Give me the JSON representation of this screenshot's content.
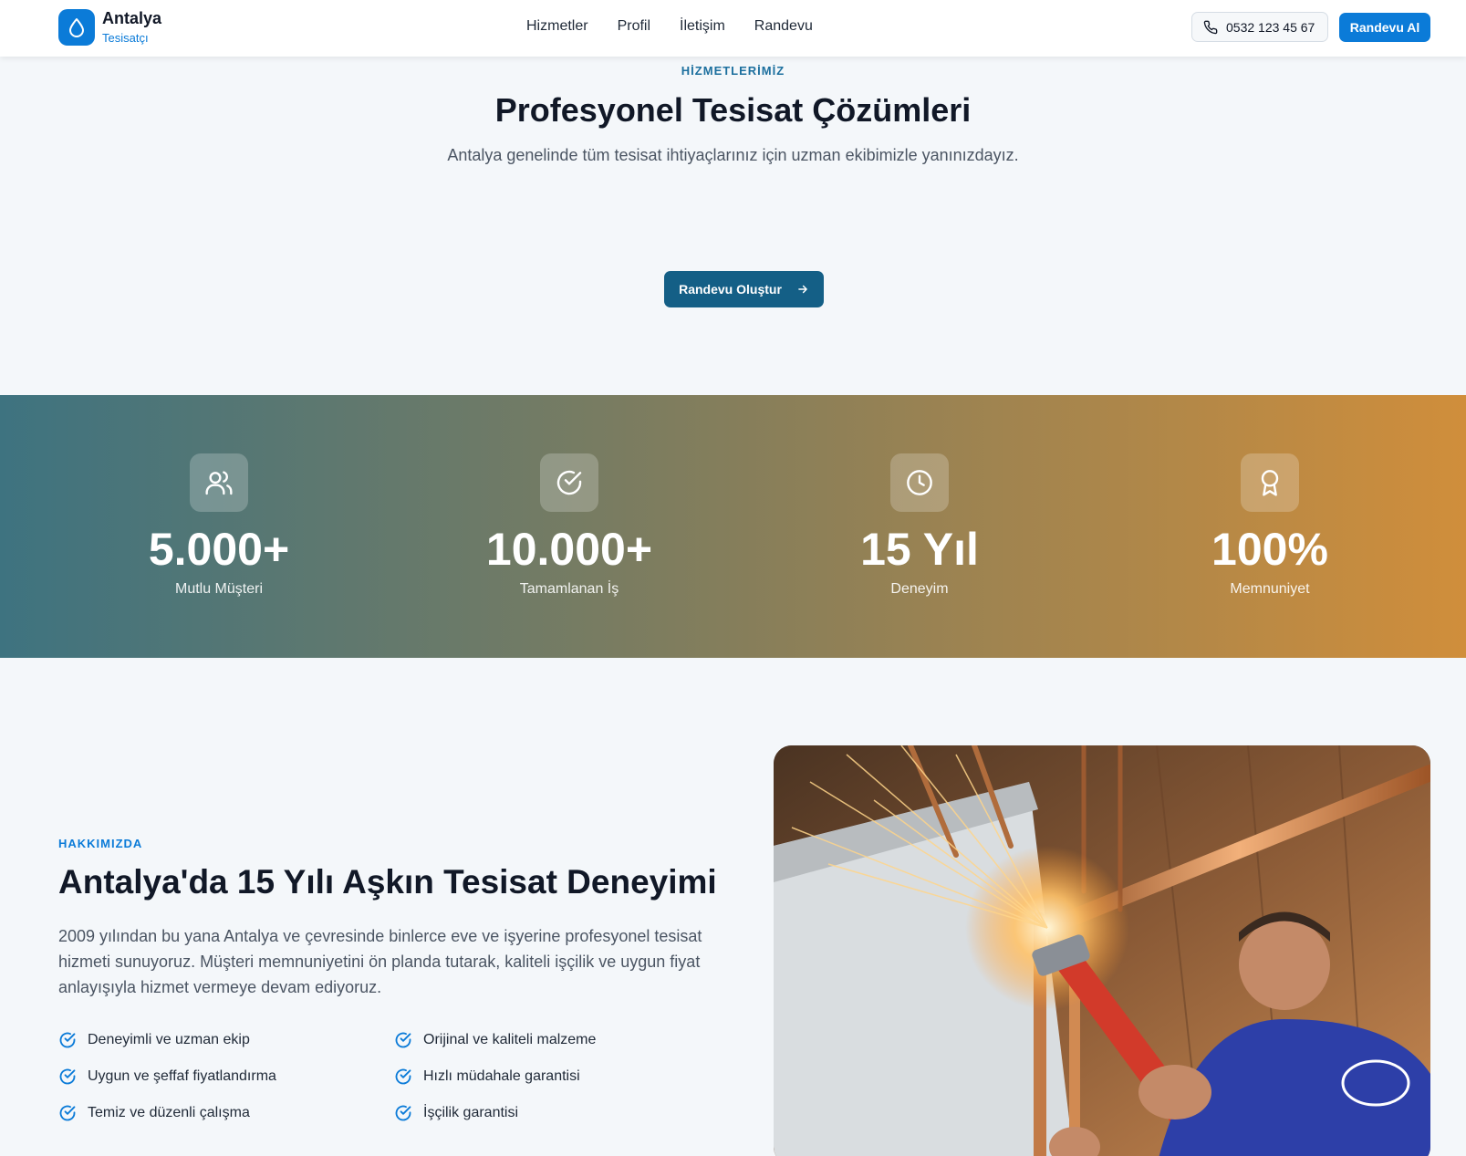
{
  "header": {
    "brand_name": "Antalya",
    "brand_sub": "Tesisatçı",
    "nav": [
      "Hizmetler",
      "Profil",
      "İletişim",
      "Randevu"
    ],
    "phone": "0532 123 45 67",
    "cta": "Randevu Al"
  },
  "services": {
    "eyebrow": "HİZMETLERİMİZ",
    "title": "Profesyonel Tesisat Çözümleri",
    "subtitle": "Antalya genelinde tüm tesisat ihtiyaçlarınız için uzman ekibimizle yanınızdayız.",
    "button": "Randevu Oluştur"
  },
  "stats": [
    {
      "value": "5.000+",
      "label": "Mutlu Müşteri",
      "icon": "users-icon"
    },
    {
      "value": "10.000+",
      "label": "Tamamlanan İş",
      "icon": "check-circle-icon"
    },
    {
      "value": "15 Yıl",
      "label": "Deneyim",
      "icon": "clock-icon"
    },
    {
      "value": "100%",
      "label": "Memnuniyet",
      "icon": "award-icon"
    }
  ],
  "about": {
    "eyebrow": "HAKKIMIZDA",
    "title": "Antalya'da 15 Yılı Aşkın Tesisat Deneyimi",
    "text": "2009 yılından bu yana Antalya ve çevresinde binlerce eve ve işyerine profesyonel tesisat hizmeti sunuyoruz. Müşteri memnuniyetini ön planda tutarak, kaliteli işçilik ve uygun fiyat anlayışıyla hizmet vermeye devam ediyoruz.",
    "features": [
      "Deneyimli ve uzman ekip",
      "Orijinal ve kaliteli malzeme",
      "Uygun ve şeffaf fiyatlandırma",
      "Hızlı müdahale garantisi",
      "Temiz ve düzenli çalışma",
      "İşçilik garantisi"
    ]
  },
  "colors": {
    "primary": "#0b7bd8",
    "dark_button": "#145f86",
    "gradient_start": "#3e7380",
    "gradient_end": "#d08e3b"
  }
}
